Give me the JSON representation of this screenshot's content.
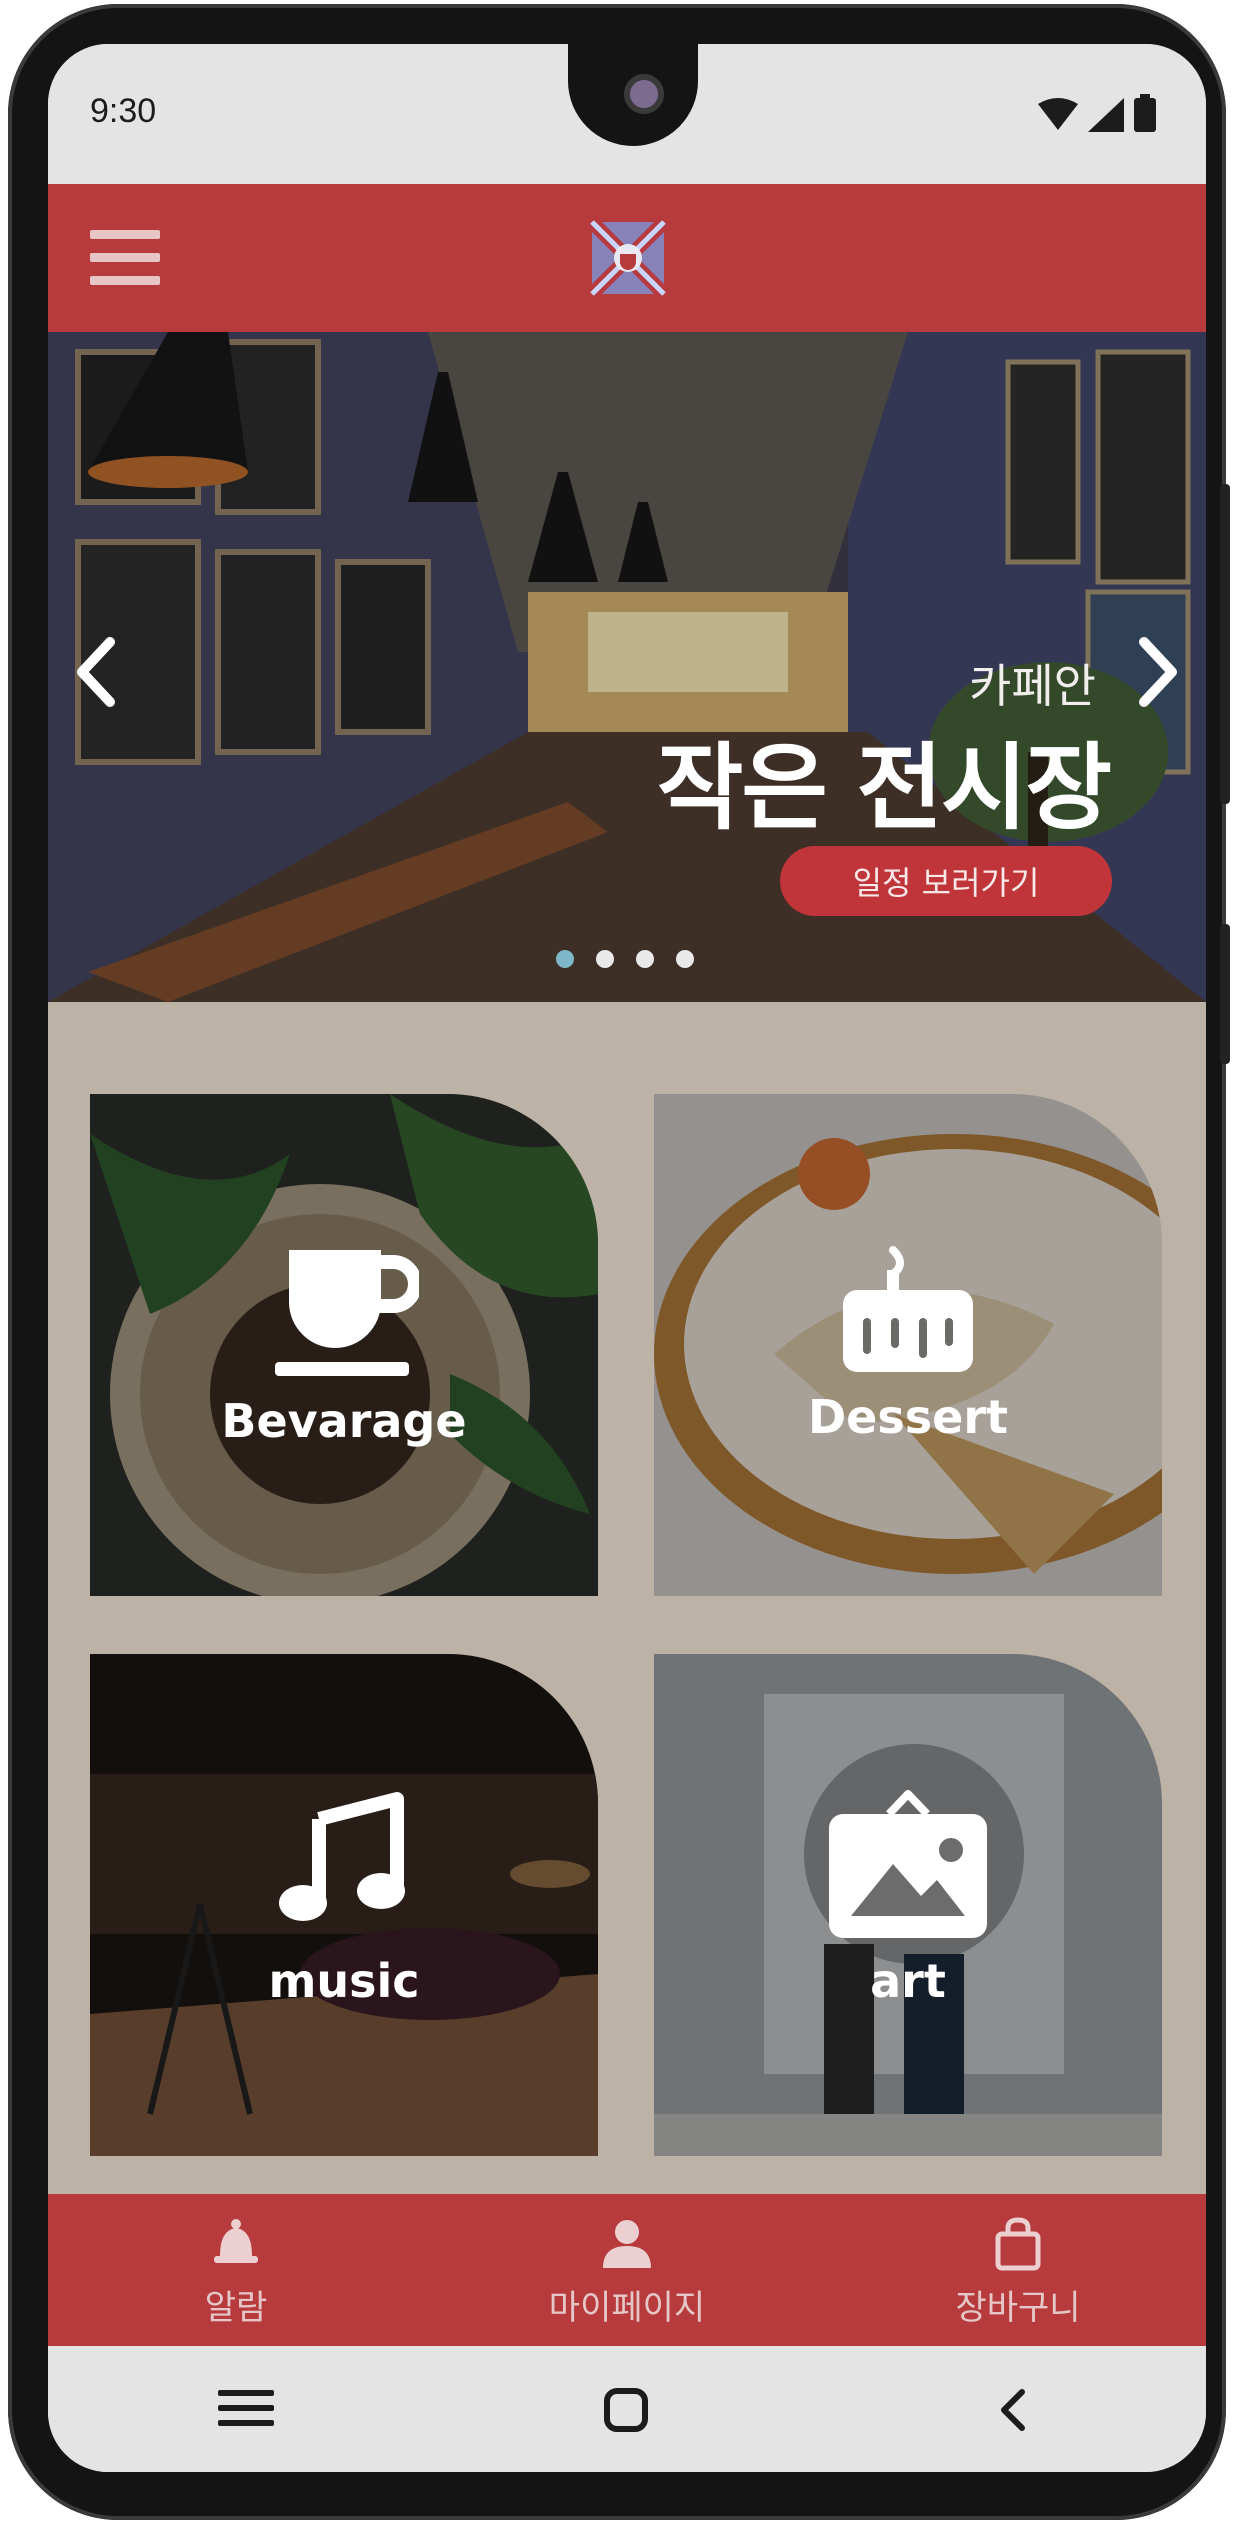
{
  "status_bar": {
    "time": "9:30"
  },
  "header": {
    "menu_icon": "hamburger-menu-icon",
    "logo_icon": "cafe-logo-icon"
  },
  "hero": {
    "subtitle": "카페안",
    "title": "작은 전시장",
    "button_label": "일정 보러가기",
    "slide_count": 4,
    "active_slide": 1
  },
  "categories": [
    {
      "label": "Bevarage",
      "icon": "coffee-cup-icon"
    },
    {
      "label": "Dessert",
      "icon": "cake-icon"
    },
    {
      "label": "music",
      "icon": "music-note-icon"
    },
    {
      "label": "art",
      "icon": "picture-icon"
    }
  ],
  "bottom_nav": [
    {
      "label": "알람",
      "icon": "bell-icon"
    },
    {
      "label": "마이페이지",
      "icon": "user-icon"
    },
    {
      "label": "장바구니",
      "icon": "shopping-bag-icon"
    }
  ],
  "colors": {
    "brand_red": "#b73a3c",
    "background_beige": "#bcb2a5"
  }
}
